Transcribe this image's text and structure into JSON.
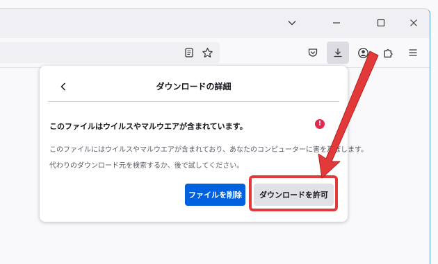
{
  "window": {
    "controls": [
      "chevron-down-icon",
      "minimize-icon",
      "maximize-icon",
      "close-icon"
    ]
  },
  "toolbar": {
    "icons": [
      "reader-view-icon",
      "bookmark-star-icon",
      "pocket-icon",
      "download-icon",
      "account-icon",
      "extensions-icon",
      "menu-icon"
    ],
    "active_icon": "download-icon"
  },
  "panel": {
    "title": "ダウンロードの詳細",
    "warning_title": "このファイルはウイルスやマルウエアが含まれています。",
    "alert_glyph": "!",
    "description_line1": "このファイルにはウイルスやマルウエアが含まれており、あなたのコンピューターに害を及ぼします。",
    "description_line2": "代わりのダウンロード元を検索するか、後で試してください。",
    "delete_button": "ファイルを削除",
    "allow_button": "ダウンロードを許可"
  },
  "colors": {
    "primary_button": "#0061e0",
    "secondary_button": "#e0e0e6",
    "alert": "#e22850",
    "annotation": "#e23a3a"
  }
}
